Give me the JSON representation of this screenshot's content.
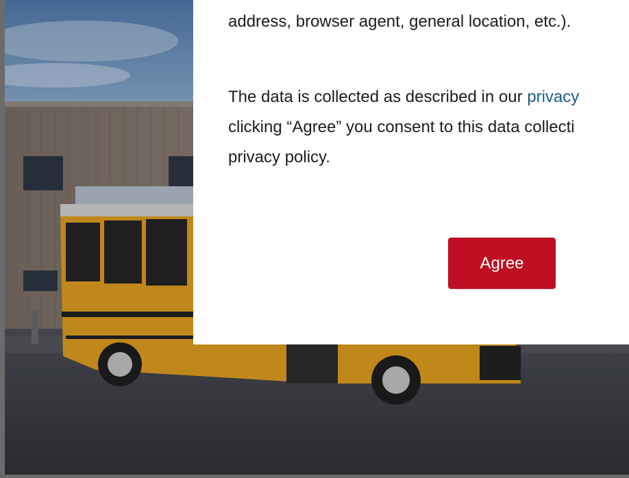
{
  "consent": {
    "paragraph1": "address, browser agent, general location, etc.).",
    "paragraph2_line1_prefix": "The data is collected as described in our ",
    "privacy_link": "privacy",
    "paragraph2_line2": "clicking “Agree” you consent to this data collecti",
    "paragraph2_line3": "privacy policy.",
    "agree_label": "Agree"
  },
  "colors": {
    "accent": "#bf0e22",
    "link": "#1a5d8c"
  }
}
